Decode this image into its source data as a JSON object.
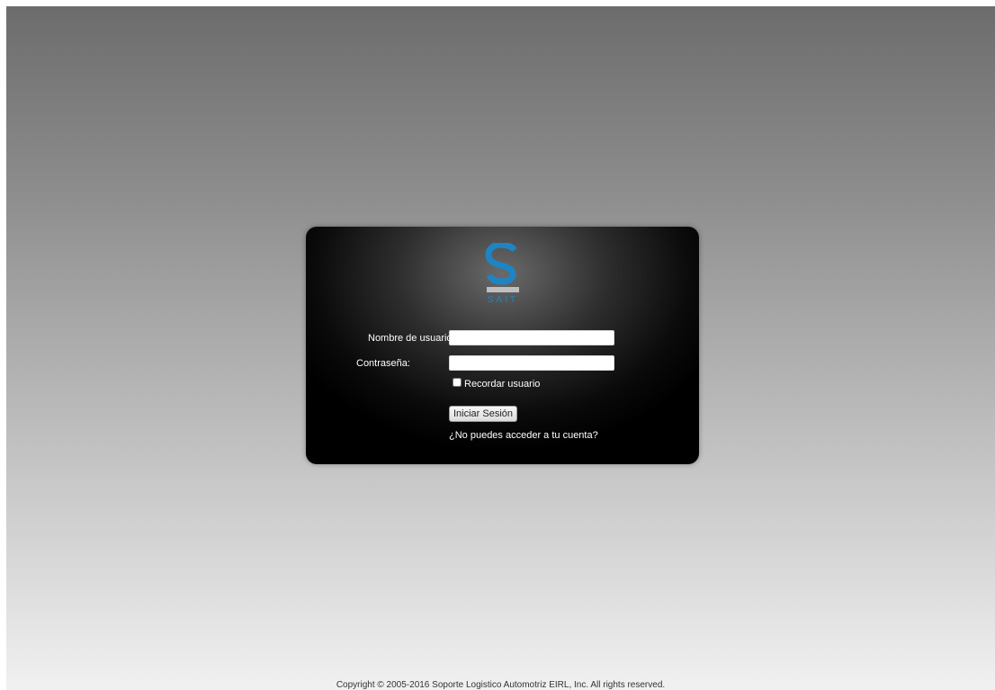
{
  "logo": {
    "text": "SAIT",
    "colors": {
      "letter": "#1f84c4",
      "bar": "#bfbfbf",
      "text": "#1f84c4"
    }
  },
  "form": {
    "username_label": "Nombre de usuario:",
    "username_value": "",
    "password_label": "Contraseña:",
    "password_value": "",
    "remember_label": "Recordar usuario",
    "remember_checked": false,
    "submit_label": "Iniciar Sesión",
    "help_link": "¿No puedes acceder a tu cuenta?"
  },
  "footer": {
    "copyright": "Copyright © 2005-2016 Soporte Logistico Automotriz EIRL, Inc. All rights reserved."
  }
}
